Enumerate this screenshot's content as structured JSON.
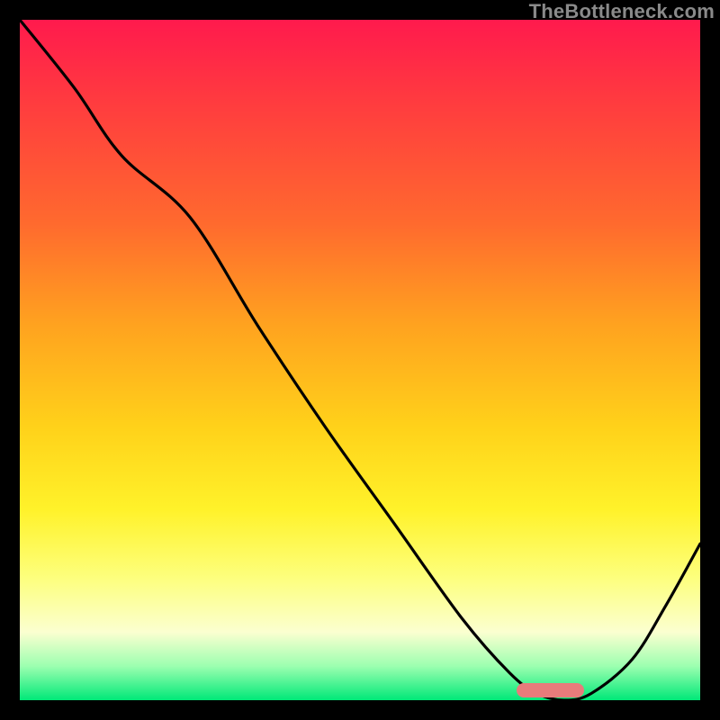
{
  "watermark": "TheBottleneck.com",
  "chart_data": {
    "type": "line",
    "title": "",
    "xlabel": "",
    "ylabel": "",
    "xlim": [
      0,
      100
    ],
    "ylim": [
      0,
      100
    ],
    "grid": false,
    "legend": false,
    "series": [
      {
        "name": "bottleneck-curve",
        "x": [
          0,
          8,
          15,
          25,
          35,
          45,
          55,
          65,
          72,
          76,
          80,
          84,
          90,
          95,
          100
        ],
        "y": [
          100,
          90,
          80,
          71,
          55,
          40,
          26,
          12,
          4,
          1,
          0,
          1,
          6,
          14,
          23
        ]
      }
    ],
    "optimal_marker": {
      "x_start": 73,
      "x_end": 83,
      "y": 1.5
    },
    "background_gradient": {
      "stops": [
        {
          "pct": 0,
          "color": "#ff1a4d"
        },
        {
          "pct": 12,
          "color": "#ff3b3f"
        },
        {
          "pct": 30,
          "color": "#ff6a2e"
        },
        {
          "pct": 45,
          "color": "#ffa31f"
        },
        {
          "pct": 60,
          "color": "#ffd21a"
        },
        {
          "pct": 72,
          "color": "#fff22a"
        },
        {
          "pct": 82,
          "color": "#fdff7d"
        },
        {
          "pct": 90,
          "color": "#fbffd0"
        },
        {
          "pct": 95,
          "color": "#9cffb0"
        },
        {
          "pct": 100,
          "color": "#00e878"
        }
      ]
    }
  }
}
